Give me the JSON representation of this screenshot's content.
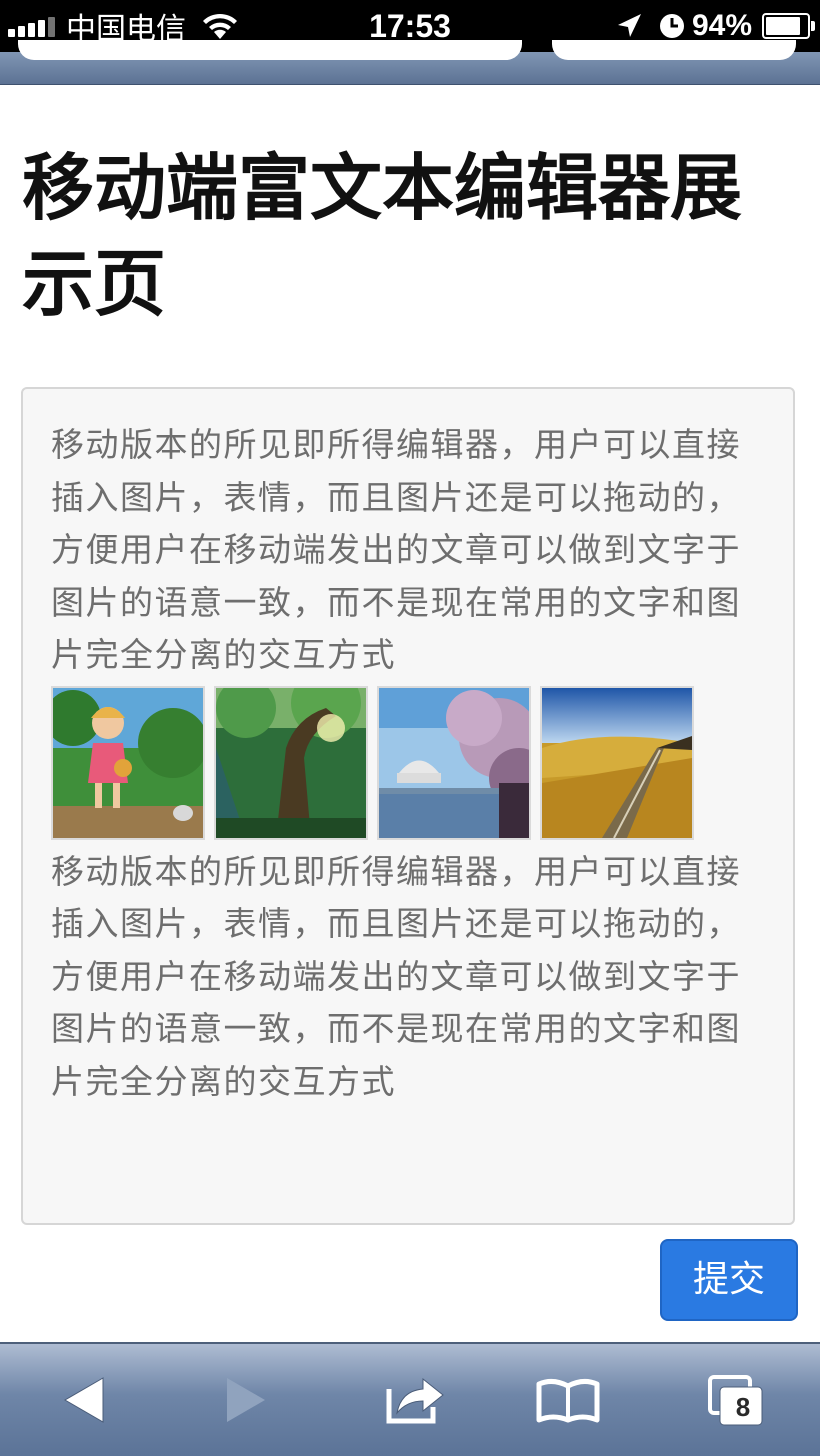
{
  "status_bar": {
    "carrier": "中国电信",
    "time": "17:53",
    "battery_percent": "94%",
    "battery_level": 0.94,
    "icons": [
      "signal-icon",
      "wifi-icon",
      "location-arrow-icon",
      "alarm-clock-icon",
      "battery-charging-icon"
    ]
  },
  "page": {
    "title": "移动端富文本编辑器展示页"
  },
  "editor": {
    "paragraph_1": "移动版本的所见即所得编辑器，用户可以直接插入图片，表情，而且图片还是可以拖动的，方便用户在移动端发出的文章可以做到文字于图片的语意一致，而不是现在常用的文字和图片完全分离的交互方式",
    "paragraph_2": "移动版本的所见即所得编辑器，用户可以直接插入图片，表情，而且图片还是可以拖动的，方便用户在移动端发出的文章可以做到文字于图片的语意一致，而不是现在常用的文字和图片完全分离的交互方式",
    "images": [
      "anime-girl-walking-image",
      "forest-tree-image",
      "cherry-blossom-lake-image",
      "golden-field-road-image"
    ]
  },
  "submit_label": "提交",
  "toolbar": {
    "tab_count": "8",
    "icons": [
      "back-arrow-icon",
      "forward-arrow-icon",
      "share-icon",
      "bookmarks-icon",
      "tabs-icon"
    ]
  },
  "colors": {
    "accent_button": "#2a7ae2",
    "toolbar_blue": "#6f86a8",
    "editor_bg": "#f7f7f7",
    "body_text": "#6e6e6e"
  }
}
